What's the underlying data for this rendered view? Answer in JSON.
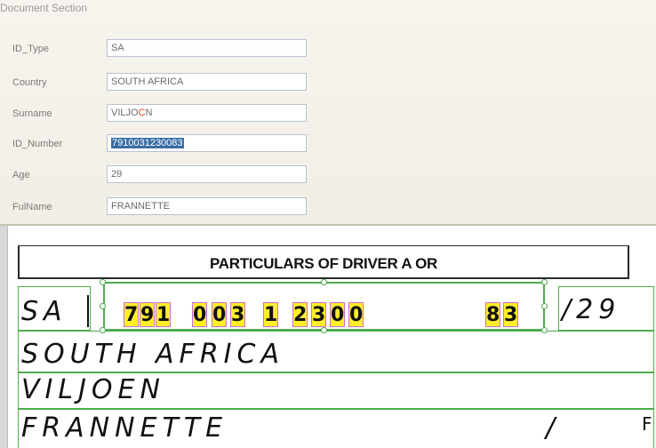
{
  "panel": {
    "title": "Document Section",
    "fields": [
      {
        "label": "ID_Type",
        "value": "SA"
      },
      {
        "label": "Country",
        "value": "SOUTH AFRICA"
      },
      {
        "label": "Surname",
        "value_a": "VILJO",
        "value_b": "C",
        "value_c": "N"
      },
      {
        "label": "ID_Number",
        "value": "7910031230083"
      },
      {
        "label": "Age",
        "value": "29"
      },
      {
        "label": "FulName",
        "value": "FRANNETTE"
      }
    ]
  },
  "scan": {
    "heading": "PARTICULARS OF DRIVER A OR",
    "id_type_hw": "SA",
    "id_digits": [
      "7",
      "9",
      "1",
      "0",
      "0",
      "3",
      "1",
      "2",
      "3",
      "0",
      "0",
      "8",
      "3"
    ],
    "age_hw": "/29",
    "country_hw": "SOUTH AFRICA",
    "surname_hw": "VILJOEN",
    "fullname_hw": "FRANNETTE",
    "slash": "/",
    "right_edge": "F"
  },
  "colors": {
    "highlight": "#ffee2a",
    "box_outline": "#4eaa4e",
    "selection": "#3a6ea5",
    "error_char": "#e04a26"
  }
}
